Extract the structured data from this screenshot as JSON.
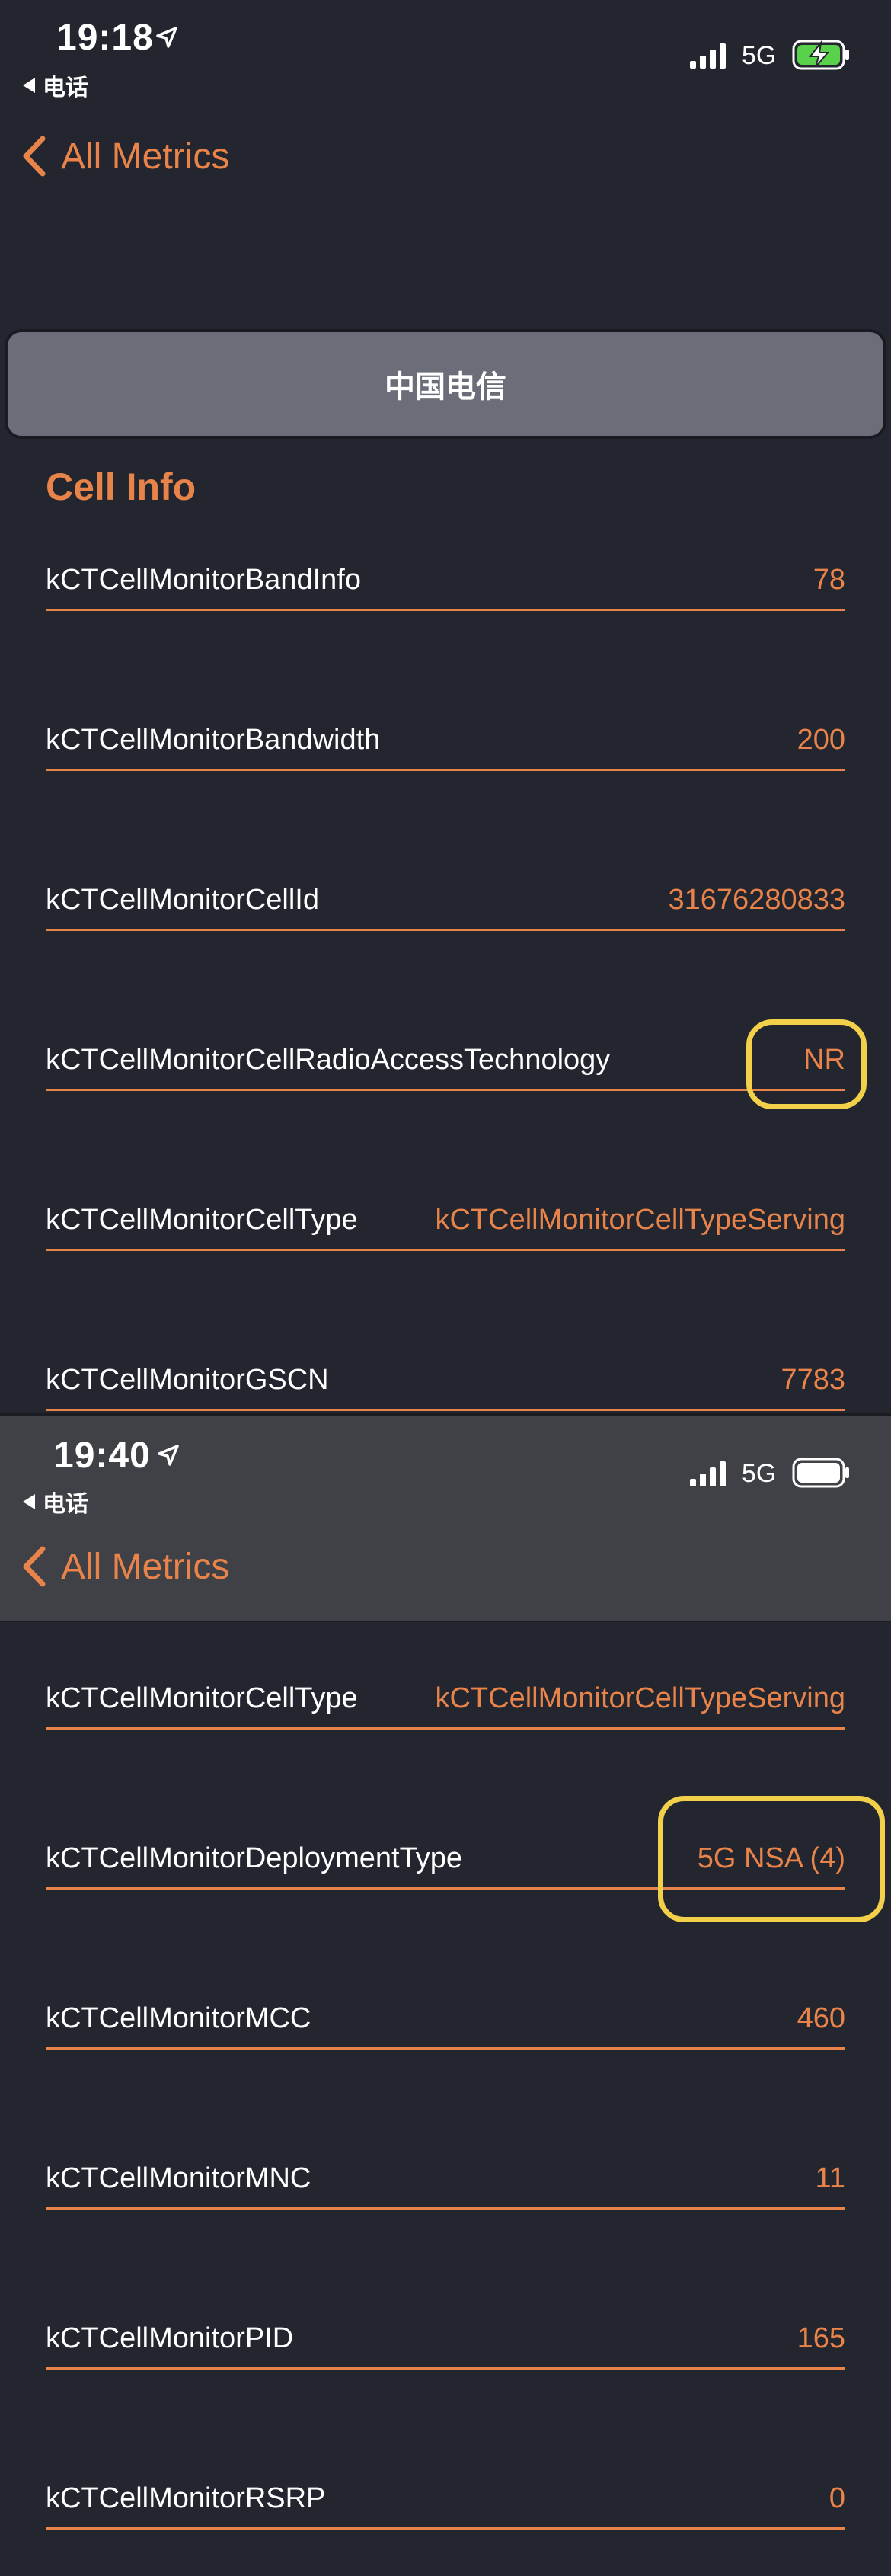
{
  "screen1": {
    "status_time": "19:18",
    "back_app_label": "电话",
    "network": "5G",
    "nav_back_label": "All Metrics",
    "carrier_button_label": "中国电信",
    "section_title": "Cell Info",
    "rows": [
      {
        "key": "kCTCellMonitorBandInfo",
        "value": "78"
      },
      {
        "key": "kCTCellMonitorBandwidth",
        "value": "200"
      },
      {
        "key": "kCTCellMonitorCellId",
        "value": "31676280833"
      },
      {
        "key": "kCTCellMonitorCellRadioAccessTechnology",
        "value": "NR"
      },
      {
        "key": "kCTCellMonitorCellType",
        "value": "kCTCellMonitorCellTypeServing"
      },
      {
        "key": "kCTCellMonitorGSCN",
        "value": "7783"
      }
    ]
  },
  "screen2": {
    "status_time": "19:40",
    "back_app_label": "电话",
    "network": "5G",
    "nav_back_label": "All Metrics",
    "rows": [
      {
        "key": "kCTCellMonitorCellType",
        "value": "kCTCellMonitorCellTypeServing"
      },
      {
        "key": "kCTCellMonitorDeploymentType",
        "value": "5G NSA (4)"
      },
      {
        "key": "kCTCellMonitorMCC",
        "value": "460"
      },
      {
        "key": "kCTCellMonitorMNC",
        "value": "11"
      },
      {
        "key": "kCTCellMonitorPID",
        "value": "165"
      },
      {
        "key": "kCTCellMonitorRSRP",
        "value": "0"
      }
    ]
  },
  "colors": {
    "accent": "#e8834a",
    "background": "#23252f",
    "highlight": "#f3d04a",
    "battery_charging": "#5ad14a"
  },
  "icons": [
    "location-arrow-icon",
    "back-triangle-icon",
    "signal-bars-icon",
    "battery-charging-icon",
    "battery-icon",
    "chevron-left-icon"
  ]
}
